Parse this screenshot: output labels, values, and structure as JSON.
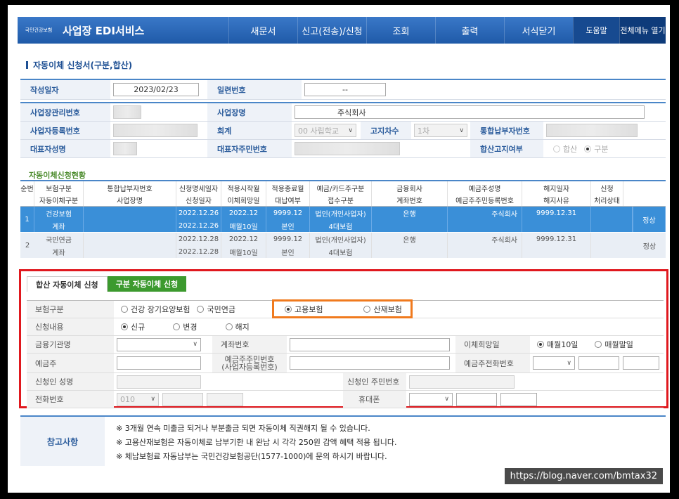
{
  "header": {
    "logo_text": "국민건강보험",
    "brand": "사업장 EDI서비스",
    "menu": [
      "새문서",
      "신고(전송)/신청",
      "조회",
      "출력",
      "서식닫기"
    ],
    "help": "도움말",
    "all_menu": "전체메뉴 열기"
  },
  "page_title": "자동이체 신청서(구분,합산)",
  "top": {
    "date_label": "작성일자",
    "date_value": "2023/02/23",
    "serial_label": "일련번호",
    "serial_value": "--"
  },
  "biz": {
    "mgmt_label": "사업장관리번호",
    "name_label": "사업장명",
    "name_value": "주식회사",
    "reg_label": "사업자등록번호",
    "account_label": "회계",
    "account_value": "00 사립학교",
    "notice_label": "고지차수",
    "notice_value": "1차",
    "unified_label": "통합납부자번호",
    "rep_label": "대표자성명",
    "rep_id_label": "대표자주민번호",
    "combined_label": "합산고지여부",
    "combined_opts": [
      "합산",
      "구분"
    ]
  },
  "status_title": "자동이체신청현황",
  "grid": {
    "h1": [
      "순번",
      "보험구분",
      "통합납부자번호",
      "신청명세일자",
      "적용시작월",
      "적용종료월",
      "예금/카드주구분",
      "금융회사",
      "예금주성명",
      "해지일자",
      "신청"
    ],
    "h2": [
      "자동이체구분",
      "사업장명",
      "신청일자",
      "이체희망일",
      "대납여부",
      "접수구분",
      "계좌번호",
      "예금주주민등록번호",
      "해지사유",
      "처리상태"
    ],
    "rows": [
      {
        "no": "1",
        "r1": [
          "건강보험",
          "",
          "2022.12.26",
          "2022.12",
          "9999.12",
          "법인(개인사업자)",
          "은행",
          "주식회사",
          "9999.12.31"
        ],
        "r2": [
          "계좌",
          "",
          "2022.12.26",
          "매월10일",
          "본인",
          "4대보험",
          "",
          "",
          ""
        ],
        "status": "정상"
      },
      {
        "no": "2",
        "r1": [
          "국민연금",
          "",
          "2022.12.28",
          "2022.12",
          "9999.12",
          "법인(개인사업자)",
          "은행",
          "주식회사",
          "9999.12.31"
        ],
        "r2": [
          "계좌",
          "",
          "2022.12.28",
          "매월10일",
          "본인",
          "4대보험",
          "",
          "",
          ""
        ],
        "status": "정상"
      }
    ]
  },
  "tabs": {
    "combined": "합산 자동이체 신청",
    "separate": "구분 자동이체 신청"
  },
  "form": {
    "ins_label": "보험구분",
    "ins_opts": [
      "건강 장기요양보험",
      "국민연금",
      "고용보험",
      "산재보험"
    ],
    "req_label": "신청내용",
    "req_opts": [
      "신규",
      "변경",
      "해지"
    ],
    "bank_label": "금융기관명",
    "acct_label": "계좌번호",
    "day_label": "이체희망일",
    "day_opts": [
      "매월10일",
      "매월말일"
    ],
    "holder_label": "예금주",
    "holder_id_label": "예금주주민번호",
    "holder_id_sub": "(사업자등록번호)",
    "holder_phone_label": "예금주전화번호",
    "applicant_label": "신청인 성명",
    "applicant_id_label": "신청인 주민번호",
    "phone_label": "전화번호",
    "phone_prefix": "010",
    "mobile_label": "휴대폰"
  },
  "notes": {
    "label": "참고사항",
    "items": [
      "※  3개월 연속 미출금 되거나 부분출금 되면 자동이체 직권해지 될 수 있습니다.",
      "※  고용산재보험은 자동이체로 납부기한 내 완납 시 각각 250원 감액 혜택 적용 됩니다.",
      "※  체납보험료 자동납부는 국민건강보험공단(1577-1000)에 문의 하시기 바랍니다."
    ]
  },
  "watermark": "https://blog.naver.com/bmtax32",
  "colors": {
    "highlight_red": "#e0181e",
    "highlight_orange": "#f07a1e",
    "header_blue": "#2a66b8",
    "selected_row": "#3a8fd8",
    "green_tab": "#3c9a2e"
  }
}
